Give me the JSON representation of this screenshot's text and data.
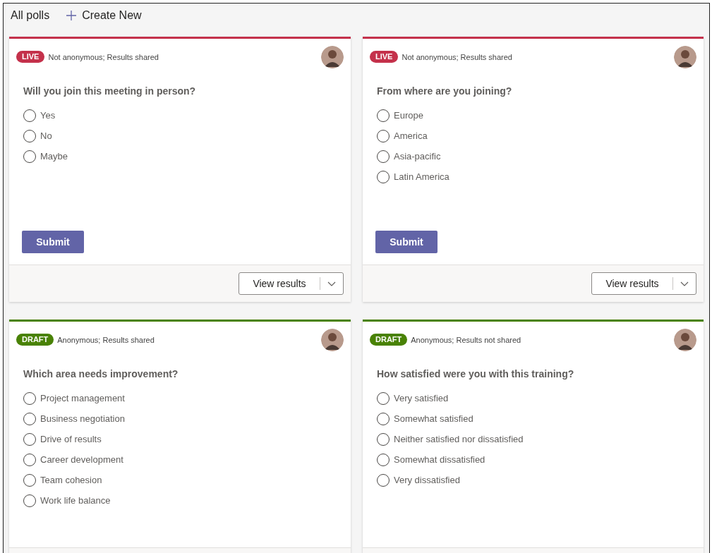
{
  "header": {
    "title": "All polls",
    "create_label": "Create New"
  },
  "polls": [
    {
      "status": {
        "kind": "live",
        "label": "LIVE"
      },
      "settings": "Not anonymous; Results shared",
      "question": "Will you join this meeting in person?",
      "options": [
        {
          "label": "Yes",
          "selected": false
        },
        {
          "label": "No",
          "selected": false
        },
        {
          "label": "Maybe",
          "selected": false
        }
      ],
      "submit_label": "Submit",
      "footer_button": "View results"
    },
    {
      "status": {
        "kind": "live",
        "label": "LIVE"
      },
      "settings": "Not anonymous; Results shared",
      "question": "From where are you joining?",
      "options": [
        {
          "label": "Europe",
          "selected": false
        },
        {
          "label": "America",
          "selected": false
        },
        {
          "label": "Asia-pacific",
          "selected": false
        },
        {
          "label": "Latin America",
          "selected": false
        }
      ],
      "submit_label": "Submit",
      "footer_button": "View results"
    },
    {
      "status": {
        "kind": "draft",
        "label": "DRAFT"
      },
      "settings": "Anonymous; Results shared",
      "question": "Which area needs improvement?",
      "options": [
        {
          "label": "Project management",
          "selected": false
        },
        {
          "label": "Business negotiation",
          "selected": false
        },
        {
          "label": "Drive of results",
          "selected": false
        },
        {
          "label": "Career development",
          "selected": false
        },
        {
          "label": "Team cohesion",
          "selected": false
        },
        {
          "label": "Work life balance",
          "selected": false
        }
      ]
    },
    {
      "status": {
        "kind": "draft",
        "label": "DRAFT"
      },
      "settings": "Anonymous; Results not shared",
      "question": "How satisfied were you with this training?",
      "options": [
        {
          "label": "Very satisfied",
          "selected": false
        },
        {
          "label": "Somewhat satisfied",
          "selected": false
        },
        {
          "label": "Neither satisfied nor dissatisfied",
          "selected": false
        },
        {
          "label": "Somewhat dissatisfied",
          "selected": false
        },
        {
          "label": "Very dissatisfied",
          "selected": false
        }
      ]
    }
  ]
}
